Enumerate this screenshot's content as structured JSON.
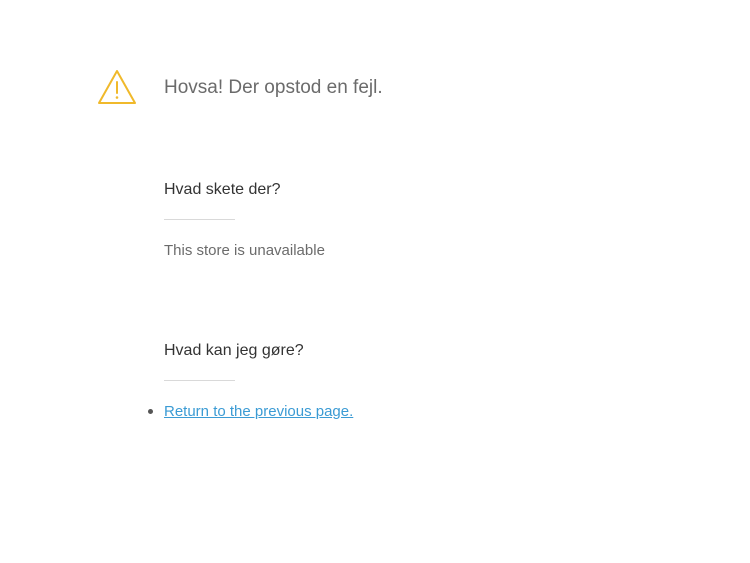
{
  "error": {
    "title": "Hovsa! Der opstod en fejl.",
    "icon": "warning-icon",
    "icon_color": "#f0b92b"
  },
  "what_happened": {
    "heading": "Hvad skete der?",
    "message": "This store is unavailable"
  },
  "what_to_do": {
    "heading": "Hvad kan jeg gøre?",
    "actions": [
      {
        "label": "Return to the previous page."
      }
    ]
  },
  "colors": {
    "link": "#3b9bd4",
    "title": "#6b6b6b",
    "heading": "#333333"
  }
}
